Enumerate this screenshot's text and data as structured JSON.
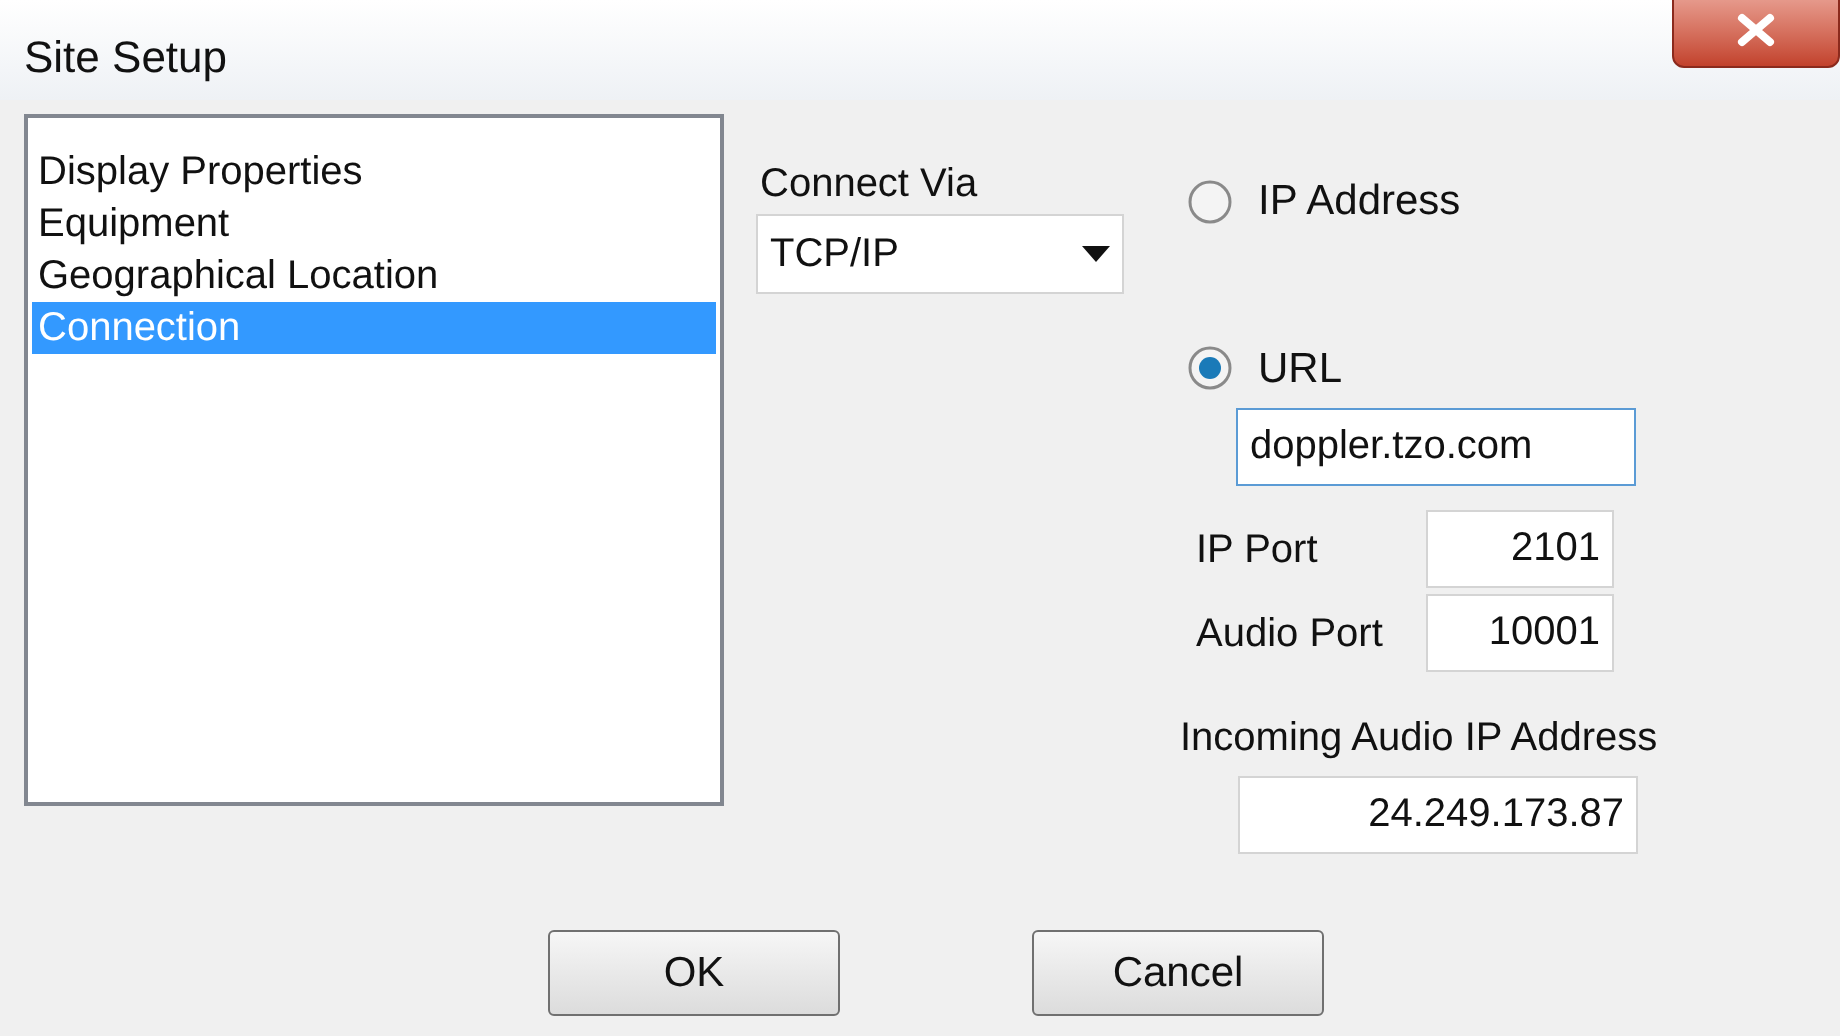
{
  "window": {
    "title": "Site Setup"
  },
  "sidebar": {
    "items": [
      {
        "label": "Display Properties",
        "selected": false
      },
      {
        "label": "Equipment",
        "selected": false
      },
      {
        "label": "Geographical Location",
        "selected": false
      },
      {
        "label": "Connection",
        "selected": true
      }
    ]
  },
  "connect_via": {
    "label": "Connect Via",
    "value": "TCP/IP"
  },
  "address_type": [
    {
      "label": "IP Address",
      "selected": false
    },
    {
      "label": "URL",
      "selected": true
    }
  ],
  "url_field": {
    "value": "doppler.tzo.com"
  },
  "ports": [
    {
      "label": "IP Port",
      "value": "2101"
    },
    {
      "label": "Audio Port",
      "value": "10001"
    }
  ],
  "incoming_audio": {
    "label": "Incoming Audio IP Address",
    "value": "24.249.173.87"
  },
  "buttons": [
    "OK",
    "Cancel"
  ]
}
